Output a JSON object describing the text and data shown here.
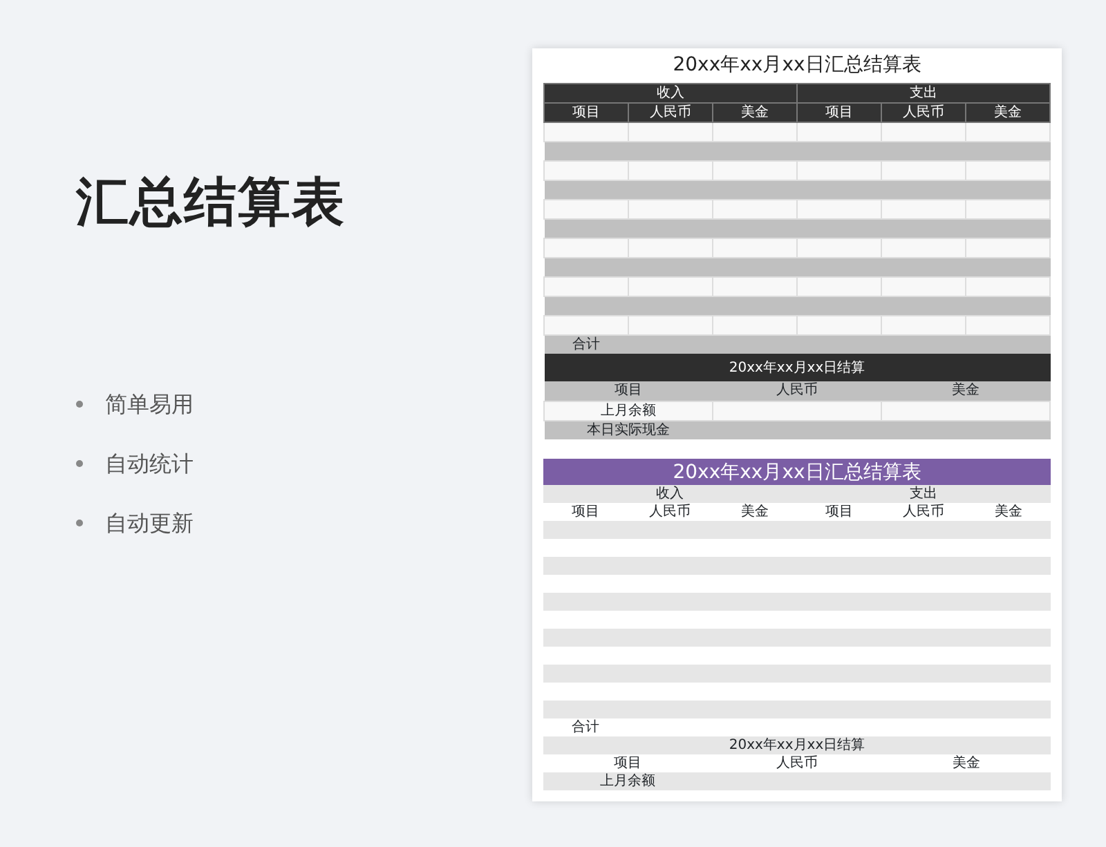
{
  "heading": "汇总结算表",
  "features": [
    "简单易用",
    "自动统计",
    "自动更新"
  ],
  "sheets": [
    {
      "kind": "dark",
      "title": "20xx年xx月xx日汇总结算表",
      "groups": [
        "收入",
        "支出"
      ],
      "columns": [
        "项目",
        "人民币",
        "美金",
        "项目",
        "人民币",
        "美金"
      ],
      "rows": [
        {
          "shaded": false
        },
        {
          "shaded": true
        },
        {
          "shaded": false
        },
        {
          "shaded": true
        },
        {
          "shaded": false
        },
        {
          "shaded": true
        },
        {
          "shaded": false
        },
        {
          "shaded": true
        },
        {
          "shaded": false
        },
        {
          "shaded": true
        },
        {
          "shaded": false
        }
      ],
      "total_label": "合计",
      "summary_title": "20xx年xx月xx日结算",
      "summary_columns": [
        "项目",
        "人民币",
        "美金"
      ],
      "summary_rows": [
        {
          "label": "上月余额",
          "shaded": false
        },
        {
          "label": "本日实际现金",
          "shaded": true
        }
      ]
    },
    {
      "kind": "purple",
      "title": "20xx年xx月xx日汇总结算表",
      "groups": [
        "收入",
        "支出"
      ],
      "columns": [
        "项目",
        "人民币",
        "美金",
        "项目",
        "人民币",
        "美金"
      ],
      "rows": [
        {
          "shaded": true
        },
        {
          "shaded": false
        },
        {
          "shaded": true
        },
        {
          "shaded": false
        },
        {
          "shaded": true
        },
        {
          "shaded": false
        },
        {
          "shaded": true
        },
        {
          "shaded": false
        },
        {
          "shaded": true
        },
        {
          "shaded": false
        },
        {
          "shaded": true
        }
      ],
      "total_label": "合计",
      "summary_title": "20xx年xx月xx日结算",
      "summary_columns": [
        "项目",
        "人民币",
        "美金"
      ],
      "summary_rows": [
        {
          "label": "上月余额",
          "shaded": true
        }
      ]
    }
  ]
}
